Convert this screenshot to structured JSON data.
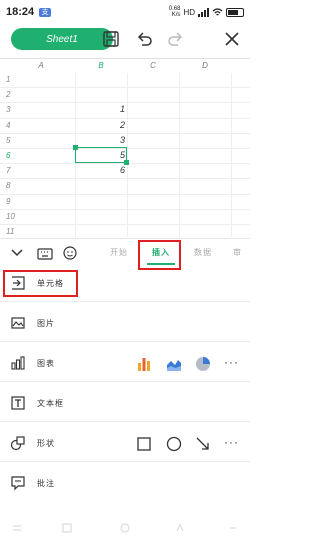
{
  "status_bar": {
    "time": "18:24",
    "app_badge": "支",
    "speed_top": "0.68",
    "speed_bottom": "K/s",
    "network": "HD",
    "signal_label": "4G"
  },
  "toolbar": {
    "sheet_name": "Sheet1"
  },
  "grid": {
    "columns": [
      "A",
      "B",
      "C",
      "D"
    ],
    "selected_column": "B",
    "rows": [
      {
        "num": "1",
        "b": ""
      },
      {
        "num": "2",
        "b": ""
      },
      {
        "num": "3",
        "b": "1"
      },
      {
        "num": "4",
        "b": "2"
      },
      {
        "num": "5",
        "b": "3"
      },
      {
        "num": "6",
        "b": "5"
      },
      {
        "num": "7",
        "b": "6"
      },
      {
        "num": "8",
        "b": ""
      },
      {
        "num": "9",
        "b": ""
      },
      {
        "num": "10",
        "b": ""
      },
      {
        "num": "11",
        "b": ""
      },
      {
        "num": "12",
        "b": ""
      },
      {
        "num": "13",
        "b": ""
      }
    ],
    "selected_row": "6"
  },
  "ribbon": {
    "tabs": [
      {
        "label": "开始",
        "active": false
      },
      {
        "label": "插入",
        "active": true
      },
      {
        "label": "数据",
        "active": false
      },
      {
        "label": "审",
        "active": false
      }
    ]
  },
  "insert_menu": {
    "items": [
      {
        "label": "单元格",
        "icon": "insert-cell-icon"
      },
      {
        "label": "图片",
        "icon": "picture-icon"
      },
      {
        "label": "图表",
        "icon": "chart-icon"
      },
      {
        "label": "文本框",
        "icon": "textbox-icon"
      },
      {
        "label": "形状",
        "icon": "shape-icon"
      },
      {
        "label": "批注",
        "icon": "comment-icon"
      }
    ],
    "more_label": "···"
  },
  "colors": {
    "accent": "#1fb070",
    "highlight": "#e02020"
  }
}
